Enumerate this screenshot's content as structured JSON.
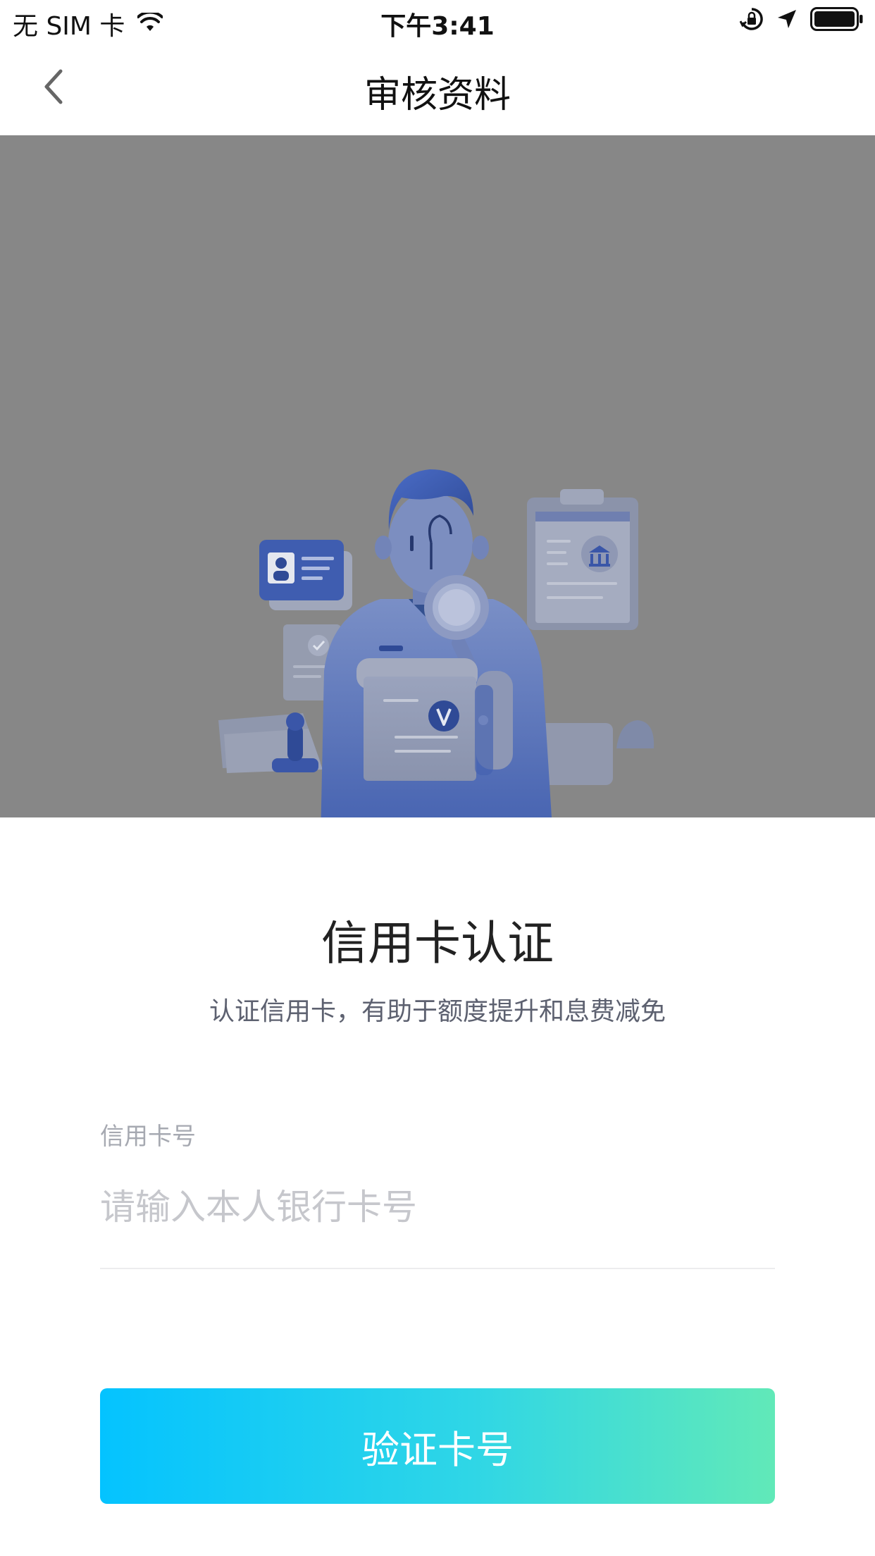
{
  "status_bar": {
    "carrier": "无 SIM 卡",
    "time": "下午3:41",
    "icons": [
      "wifi-icon",
      "orientation-lock-icon",
      "location-arrow-icon",
      "battery-icon"
    ]
  },
  "nav": {
    "title": "审核资料",
    "back_icon": "chevron-left-icon"
  },
  "hero": {
    "illustration": "credit-verification-illustration",
    "background_color": "#878787"
  },
  "content": {
    "title": "信用卡认证",
    "subtitle": "认证信用卡，有助于额度提升和息费减免"
  },
  "form": {
    "card_number_label": "信用卡号",
    "card_number_value": "",
    "card_number_placeholder": "请输入本人银行卡号"
  },
  "actions": {
    "verify_label": "验证卡号"
  },
  "colors": {
    "accent_start": "#04c3ff",
    "accent_end": "#61e9b8",
    "illustration_blue": "#3a56a8"
  }
}
